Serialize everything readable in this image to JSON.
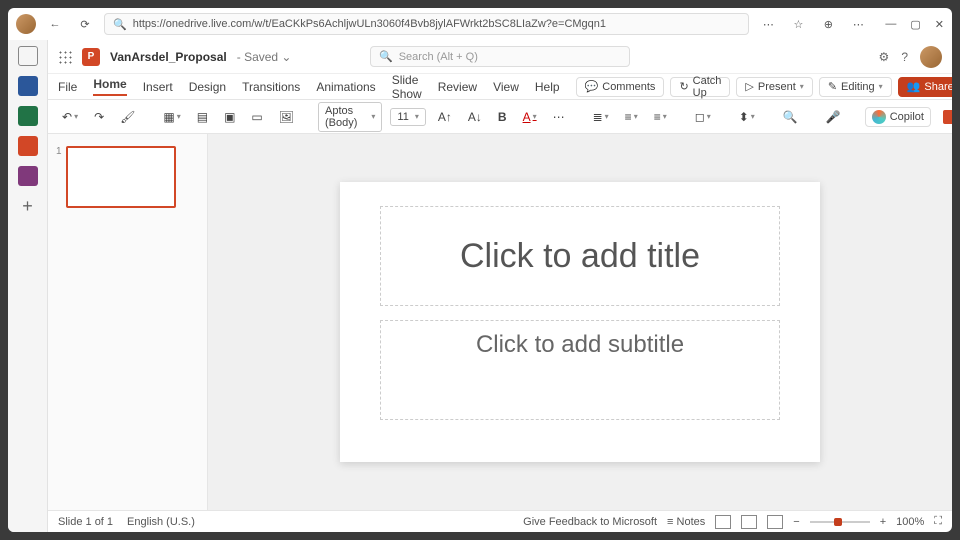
{
  "browser": {
    "url": "https://onedrive.live.com/w/t/EaCKkPs6AchljwULn3060f4Bvb8jylAFWrkt2bSC8LIaZw?e=CMgqn1"
  },
  "header": {
    "doc_name": "VanArsdel_Proposal",
    "saved_state": "Saved",
    "search_placeholder": "Search (Alt + Q)"
  },
  "ribbon": {
    "tabs": [
      "File",
      "Home",
      "Insert",
      "Design",
      "Transitions",
      "Animations",
      "Slide Show",
      "Review",
      "View",
      "Help"
    ],
    "active_tab": "Home",
    "comments": "Comments",
    "catchup": "Catch Up",
    "present": "Present",
    "editing": "Editing",
    "share": "Share"
  },
  "toolbar": {
    "font": "Aptos (Body)",
    "size": "11",
    "copilot": "Copilot"
  },
  "slide": {
    "title_ph": "Click to add title",
    "subtitle_ph": "Click to add subtitle"
  },
  "thumbs": {
    "first": "1"
  },
  "status": {
    "slide_info": "Slide 1 of 1",
    "language": "English (U.S.)",
    "feedback": "Give Feedback to Microsoft",
    "notes": "Notes",
    "zoom": "100%"
  }
}
